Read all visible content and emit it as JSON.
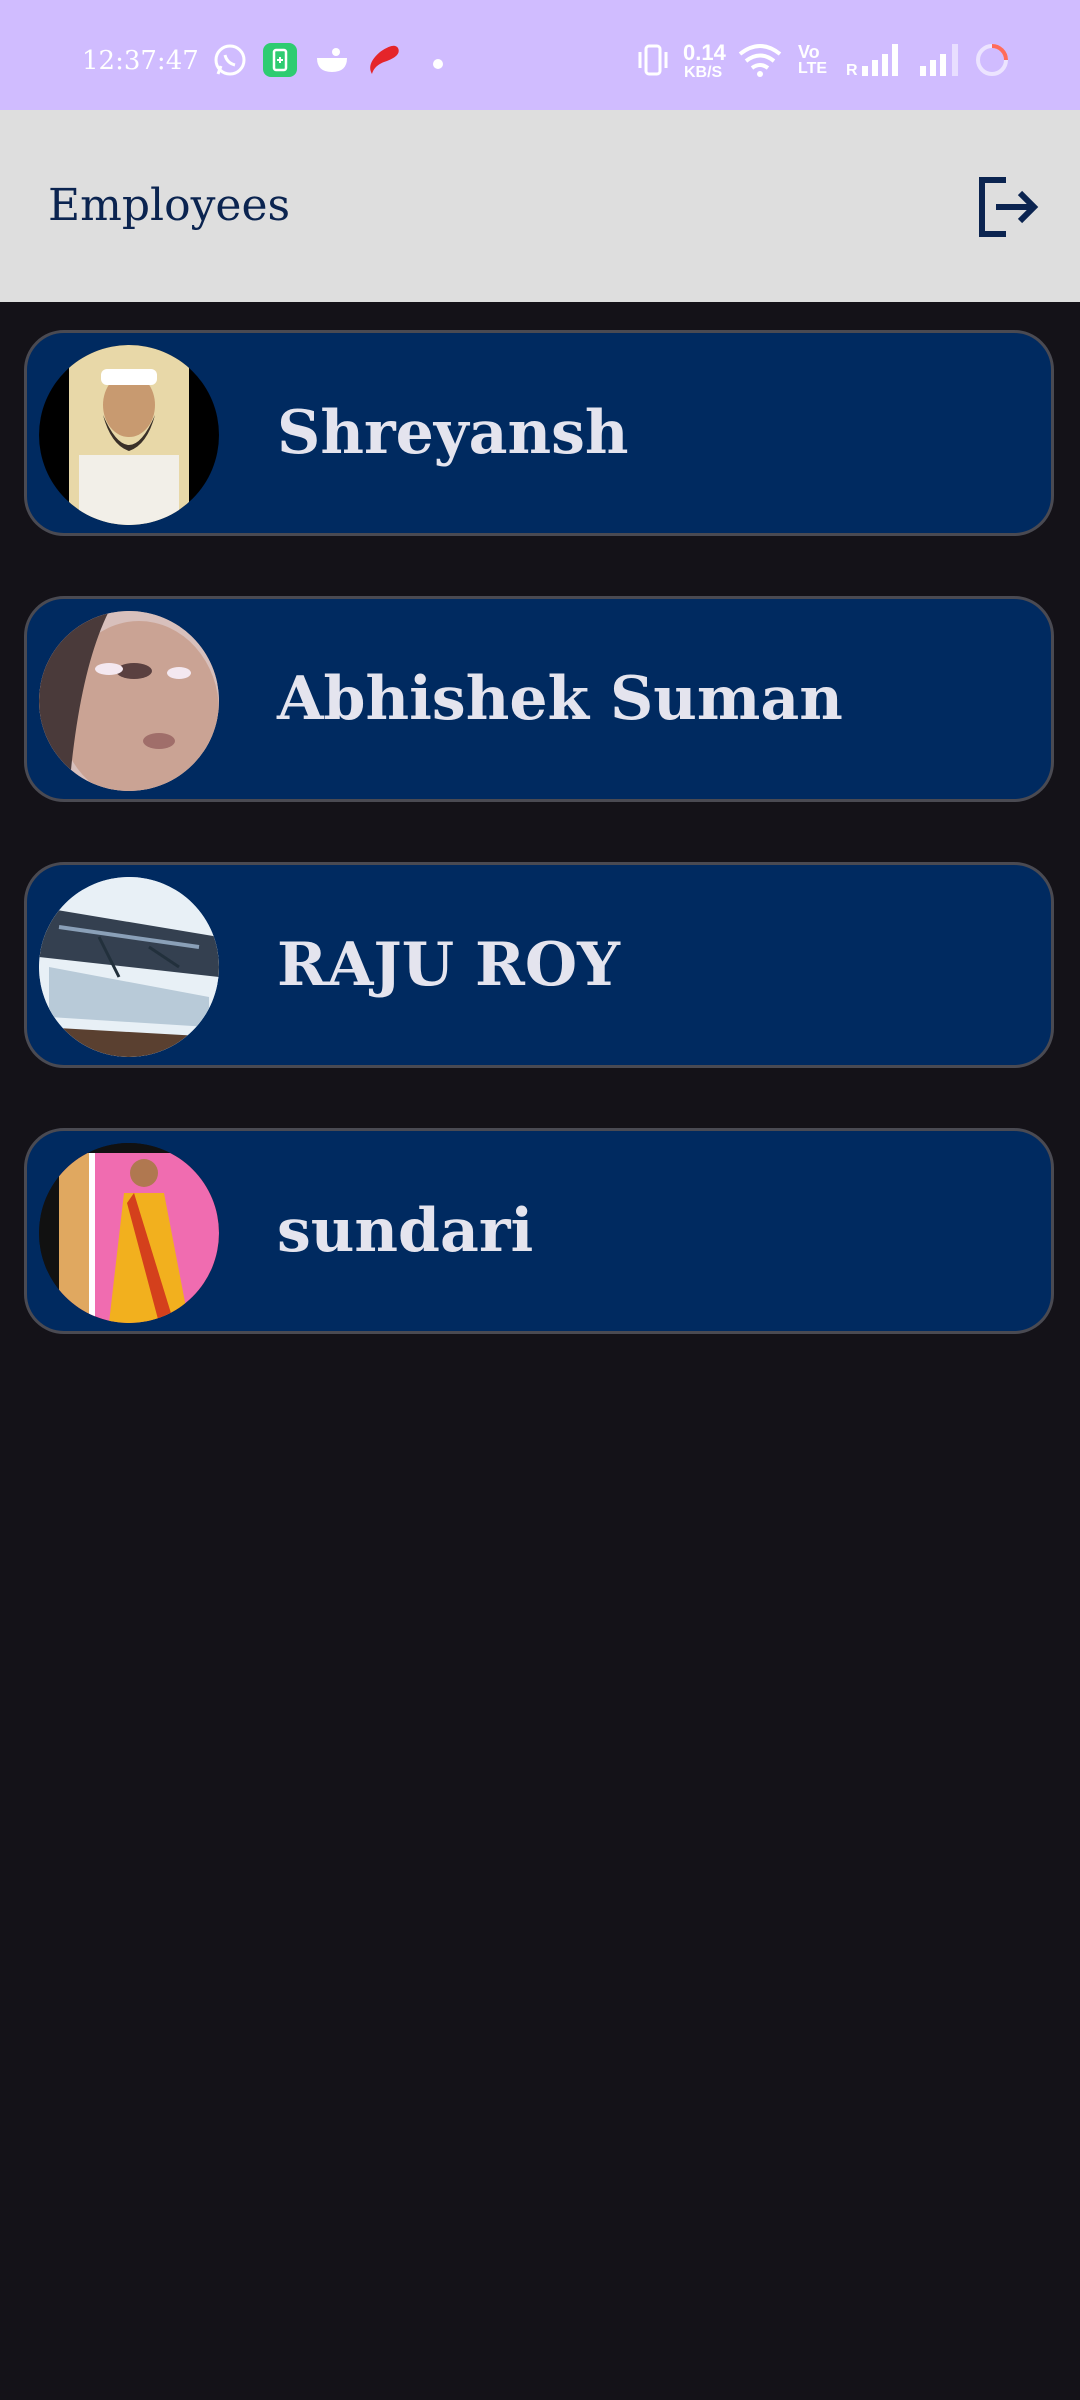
{
  "status_bar": {
    "time": "12:37:47",
    "speed_value": "0.14",
    "speed_unit": "KB/S",
    "volte_top": "Vo",
    "volte_bottom": "LTE",
    "roaming": "R",
    "icons": [
      "whatsapp-icon",
      "battery-saver-icon",
      "app-icon",
      "airtel-icon",
      "dot-icon",
      "vibrate-icon",
      "wifi-icon",
      "signal-icon",
      "signal-icon",
      "loading-icon"
    ]
  },
  "app_bar": {
    "title": "Employees",
    "logout_icon": "logout-icon"
  },
  "employees": [
    {
      "name": "Shreyansh"
    },
    {
      "name": "Abhishek Suman"
    },
    {
      "name": "RAJU ROY"
    },
    {
      "name": "sundari"
    }
  ],
  "colors": {
    "status_bar": "#d0bcff",
    "app_bar": "#dedede",
    "background": "#141218",
    "card": "#002a60",
    "card_border": "#4a4a52",
    "title": "#0b2450",
    "name": "#e4e4ee"
  }
}
